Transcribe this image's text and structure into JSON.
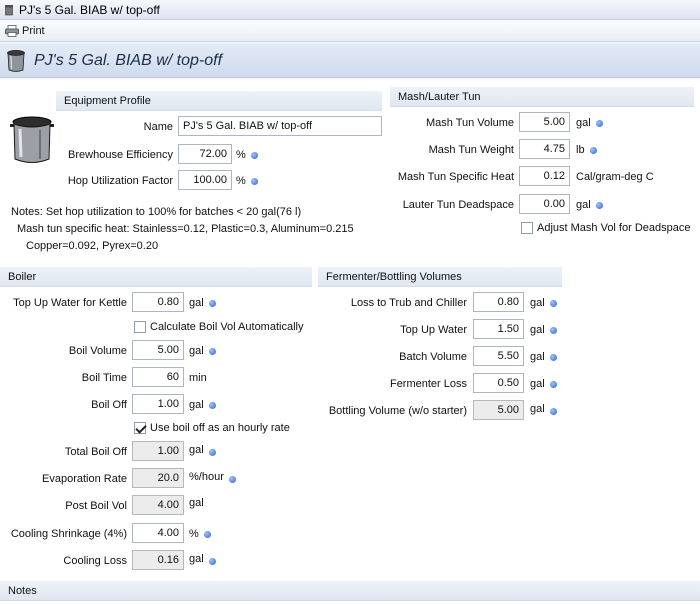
{
  "window": {
    "title": "PJ's 5 Gal. BIAB w/ top-off"
  },
  "toolbar": {
    "print_label": "Print"
  },
  "header": {
    "title": "PJ's 5 Gal. BIAB w/ top-off"
  },
  "equipment": {
    "section_label": "Equipment Profile",
    "name_label": "Name",
    "name_value": "PJ's 5 Gal. BIAB w/ top-off",
    "efficiency_label": "Brewhouse Efficiency",
    "efficiency_value": "72.00",
    "efficiency_unit": "%",
    "hop_util_label": "Hop Utilization Factor",
    "hop_util_value": "100.00",
    "hop_util_unit": "%",
    "notes": [
      "Notes: Set hop utilization to 100% for batches < 20 gal(76 l)",
      "Mash tun specific heat: Stainless=0.12, Plastic=0.3, Aluminum=0.215",
      "Copper=0.092, Pyrex=0.20"
    ]
  },
  "mash": {
    "section_label": "Mash/Lauter Tun",
    "volume_label": "Mash Tun Volume",
    "volume_value": "5.00",
    "volume_unit": "gal",
    "weight_label": "Mash Tun Weight",
    "weight_value": "4.75",
    "weight_unit": "lb",
    "heat_label": "Mash Tun Specific Heat",
    "heat_value": "0.12",
    "heat_unit": "Cal/gram-deg C",
    "deadspace_label": "Lauter Tun Deadspace",
    "deadspace_value": "0.00",
    "deadspace_unit": "gal",
    "adjust_label": "Adjust Mash Vol for Deadspace",
    "adjust_checked": false
  },
  "boiler": {
    "section_label": "Boiler",
    "topup_label": "Top Up Water for Kettle",
    "topup_value": "0.80",
    "topup_unit": "gal",
    "calc_label": "Calculate Boil Vol Automatically",
    "calc_checked": false,
    "volume_label": "Boil Volume",
    "volume_value": "5.00",
    "volume_unit": "gal",
    "time_label": "Boil Time",
    "time_value": "60",
    "time_unit": "min",
    "off_label": "Boil Off",
    "off_value": "1.00",
    "off_unit": "gal",
    "hourly_label": "Use boil off as an hourly rate",
    "hourly_checked": true,
    "total_off_label": "Total Boil Off",
    "total_off_value": "1.00",
    "total_off_unit": "gal",
    "evap_label": "Evaporation Rate",
    "evap_value": "20.0",
    "evap_unit": "%/hour",
    "post_label": "Post Boil Vol",
    "post_value": "4.00",
    "post_unit": "gal",
    "shrink_label": "Cooling Shrinkage (4%)",
    "shrink_value": "4.00",
    "shrink_unit": "%",
    "loss_label": "Cooling Loss",
    "loss_value": "0.16",
    "loss_unit": "gal"
  },
  "fermenter": {
    "section_label": "Fermenter/Bottling Volumes",
    "trub_label": "Loss to Trub and Chiller",
    "trub_value": "0.80",
    "trub_unit": "gal",
    "topup_label": "Top Up Water",
    "topup_value": "1.50",
    "topup_unit": "gal",
    "batch_label": "Batch Volume",
    "batch_value": "5.50",
    "batch_unit": "gal",
    "loss_label": "Fermenter Loss",
    "loss_value": "0.50",
    "loss_unit": "gal",
    "bottling_label": "Bottling Volume (w/o starter)",
    "bottling_value": "5.00",
    "bottling_unit": "gal"
  },
  "notes": {
    "section_label": "Notes"
  }
}
